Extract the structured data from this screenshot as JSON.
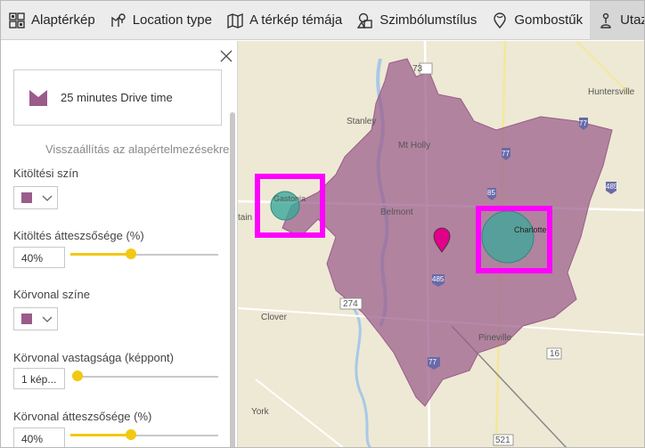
{
  "toolbar": {
    "items": [
      {
        "label": "Alaptérkép",
        "icon": "grid-map-icon"
      },
      {
        "label": "Location type",
        "icon": "location-type-icon"
      },
      {
        "label": "A térkép témája",
        "icon": "map-theme-icon"
      },
      {
        "label": "Szimbólumstílus",
        "icon": "symbol-style-icon"
      },
      {
        "label": "Gombostűk",
        "icon": "pin-icon"
      },
      {
        "label": "Utazási i",
        "icon": "travel-icon"
      }
    ]
  },
  "panel": {
    "preset_label": "25 minutes Drive time",
    "reset_link": "Visszaállítás az alapértelmezésekre",
    "fill_color_label": "Kitöltési szín",
    "fill_color": "#9a5c8a",
    "fill_opacity_label": "Kitöltés átteszsősége (%)",
    "fill_opacity_value": "40%",
    "fill_opacity_level": 0.4,
    "border_color_label": "Körvonal színe",
    "border_color": "#9a5c8a",
    "border_width_label": "Körvonal vastagsága (képpont)",
    "border_width_value": "1 kép...",
    "border_width_level": 0.0,
    "border_opacity_label": "Körvonal átteszsősége (%)",
    "border_opacity_value": "40%",
    "border_opacity_level": 0.4
  },
  "map": {
    "labels": {
      "huntersville": "Huntersville",
      "stanley": "Stanley",
      "mt_holly": "Mt Holly",
      "gastonia": "Gastonia",
      "belmont": "Belmont",
      "charlotte": "Charlotte",
      "clover": "Clover",
      "pineville": "Pineville",
      "york": "York",
      "tain": "tain"
    },
    "shields": {
      "r73": "73",
      "r77a": "77",
      "r77b": "77",
      "r85": "85",
      "r485": "485",
      "r274": "274",
      "r16": "16",
      "r521": "521",
      "r77c": "77",
      "r485b": "485"
    },
    "colors": {
      "drive_area": "#9a5c8a",
      "bubble": "#3aa89a",
      "highlight": "#ff00ff",
      "pin": "#e0008a"
    }
  }
}
